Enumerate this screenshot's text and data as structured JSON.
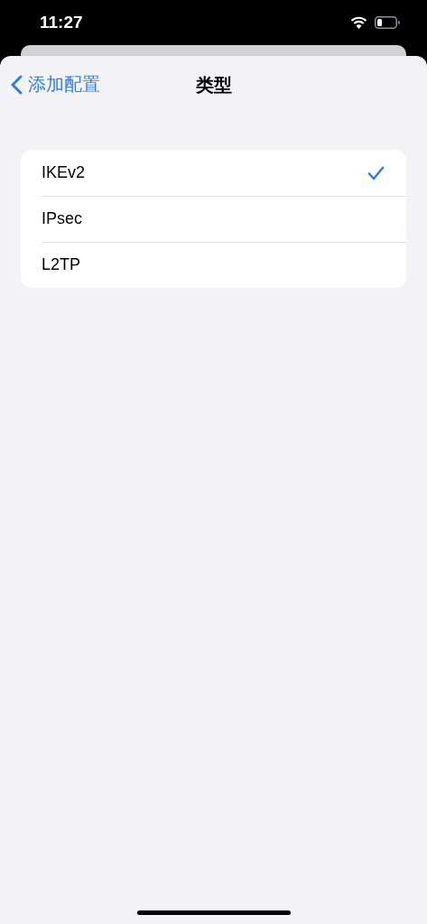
{
  "status_bar": {
    "time": "11:27"
  },
  "nav": {
    "back_label": "添加配置",
    "title": "类型"
  },
  "options": [
    {
      "label": "IKEv2",
      "selected": true
    },
    {
      "label": "IPsec",
      "selected": false
    },
    {
      "label": "L2TP",
      "selected": false
    }
  ]
}
